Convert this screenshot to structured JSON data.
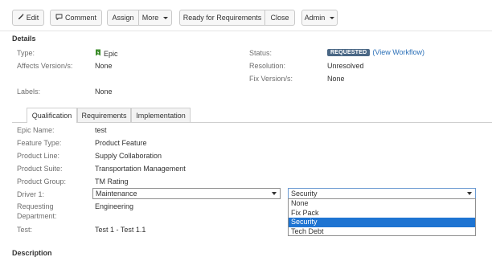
{
  "toolbar": {
    "edit": "Edit",
    "comment": "Comment",
    "assign": "Assign",
    "more": "More",
    "ready": "Ready for Requirements",
    "close": "Close",
    "admin": "Admin"
  },
  "details": {
    "title": "Details",
    "type_label": "Type:",
    "type_value": "Epic",
    "affects_label": "Affects Version/s:",
    "affects_value": "None",
    "labels_label": "Labels:",
    "labels_value": "None",
    "status_label": "Status:",
    "status_value": "REQUESTED",
    "workflow_link": "(View Workflow)",
    "resolution_label": "Resolution:",
    "resolution_value": "Unresolved",
    "fix_label": "Fix Version/s:",
    "fix_value": "None"
  },
  "tabs": [
    "Qualification",
    "Requirements",
    "Implementation"
  ],
  "fields": {
    "epic_name_label": "Epic Name:",
    "epic_name_value": "test",
    "feature_type_label": "Feature Type:",
    "feature_type_value": "Product Feature",
    "product_line_label": "Product Line:",
    "product_line_value": "Supply Collaboration",
    "product_suite_label": "Product Suite:",
    "product_suite_value": "Transportation Management",
    "product_group_label": "Product Group:",
    "product_group_value": "TM Rating",
    "driver_label": "Driver 1:",
    "driver_value": "Maintenance",
    "driver2_value": "Security",
    "requesting_label_1": "Requesting",
    "requesting_label_2": "Department:",
    "requesting_value": "Engineering",
    "test_label": "Test:",
    "test_value": "Test 1 - Test 1.1"
  },
  "dropdown_options": [
    "None",
    "Fix Pack",
    "Security",
    "Tech Debt"
  ],
  "next_section_partial": "Description",
  "colors": {
    "lozenge": "#4a6785",
    "link": "#2a6fb7",
    "selected_option": "#1e74d2",
    "epic_icon": "#3b8c2a"
  }
}
